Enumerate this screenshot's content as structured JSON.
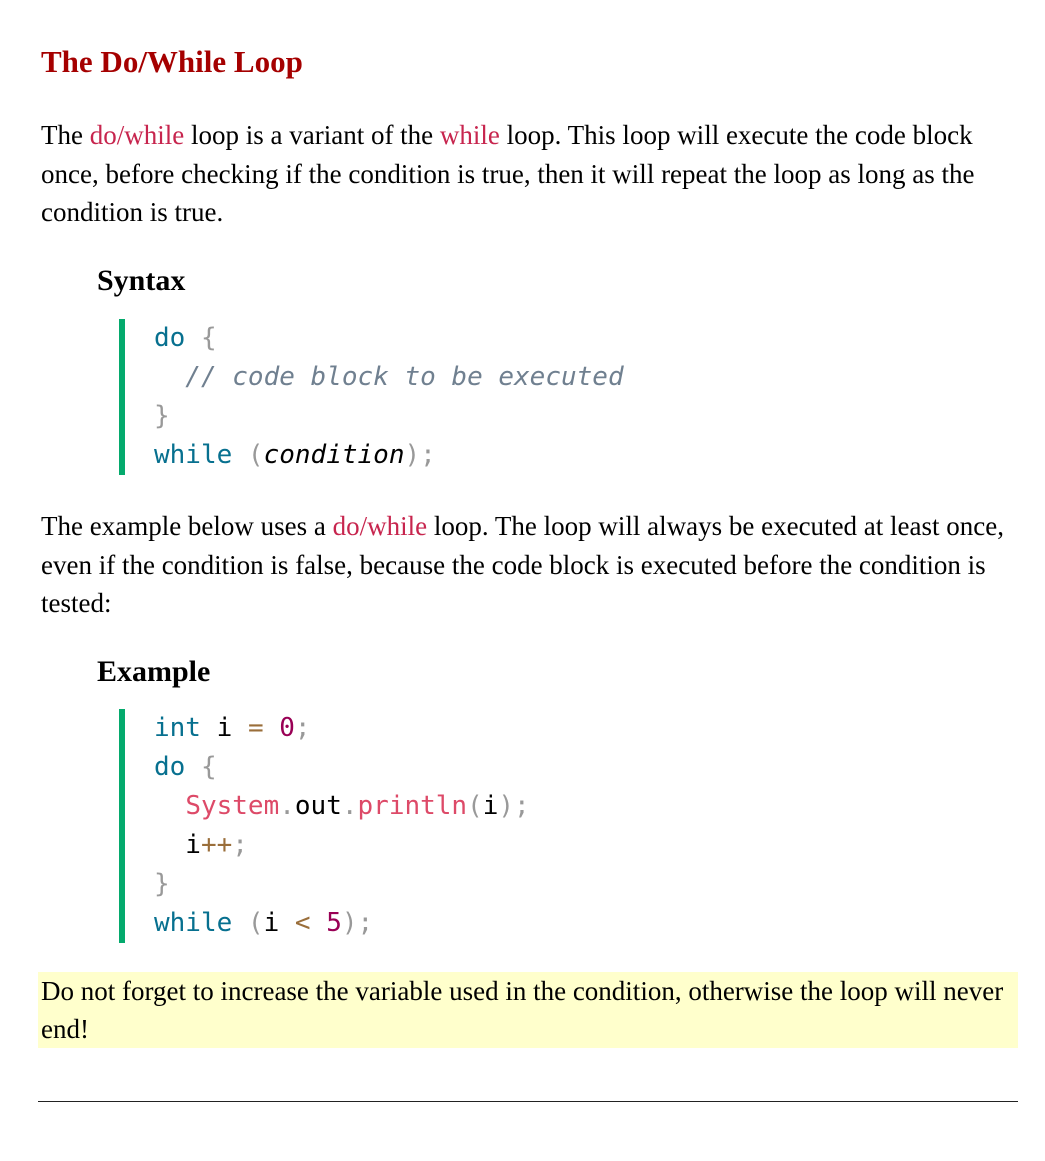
{
  "title": "The Do/While Loop",
  "intro": {
    "t1": "The ",
    "k1": "do/while",
    "t2": " loop is a variant of the ",
    "k2": "while",
    "t3": " loop. This loop will execute the code block once, before checking if the condition is true, then it will repeat the loop as long as the condition is true."
  },
  "syntax": {
    "heading": "Syntax",
    "lines": {
      "l1a": "do",
      "l1b": " {",
      "l2": "  // code block to be executed",
      "l3": "}",
      "l4a": "while",
      "l4b": " (",
      "l4c": "condition",
      "l4d": ");"
    }
  },
  "example_intro": {
    "t1": "The example below uses a ",
    "k1": "do/while",
    "t2": " loop. The loop will always be executed at least once, even if the condition is false, because the code block is executed before the condition is tested:"
  },
  "example": {
    "heading": "Example",
    "lines": {
      "a1": "int",
      "a2": " i ",
      "a3": "=",
      "a4": " ",
      "a5": "0",
      "a6": ";",
      "b1": "do",
      "b2": " {",
      "c0": "  ",
      "c1": "System",
      "c2": ".",
      "c3": "out",
      "c4": ".",
      "c5": "println",
      "c6": "(",
      "c7": "i",
      "c8": ");",
      "d0": "  i",
      "d1": "++",
      "d2": ";",
      "e1": "}",
      "f1": "while",
      "f2": " (",
      "f3": "i ",
      "f4": "<",
      "f5": " ",
      "f6": "5",
      "f7": ");"
    }
  },
  "note": "Do not forget to increase the variable used in the condition, otherwise the loop will never end!",
  "colors": {
    "heading": "#a50000",
    "keyword_link": "#c7254e",
    "code_bar": "#04aa6d",
    "note_bg": "#ffffcc"
  }
}
